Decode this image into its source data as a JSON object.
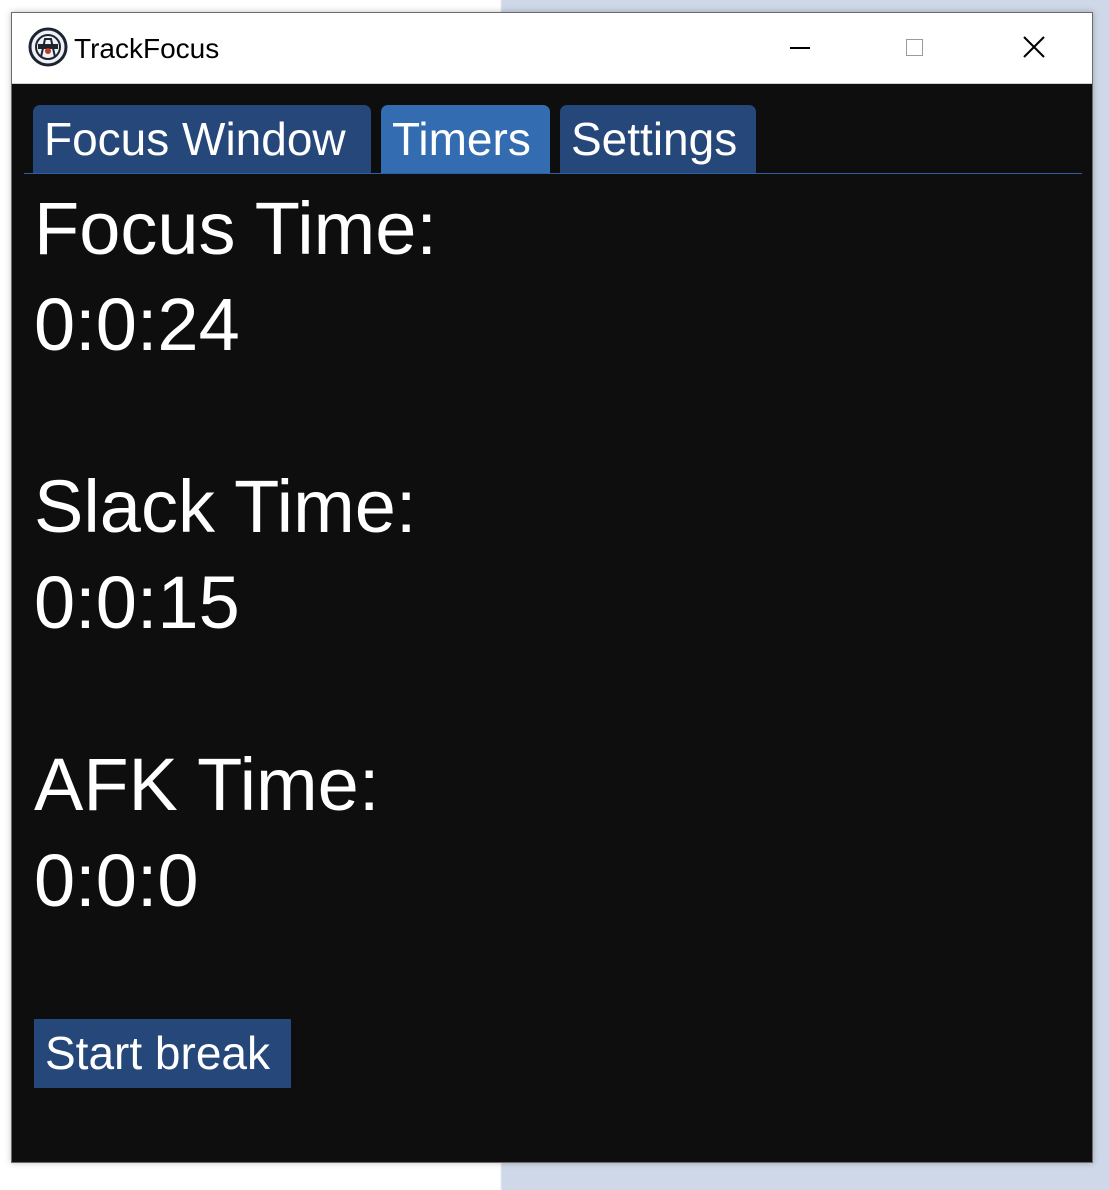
{
  "window": {
    "title": "TrackFocus",
    "controls": {
      "minimize": "minimize-icon",
      "maximize": "maximize-icon",
      "close": "close-icon"
    }
  },
  "tabs": [
    {
      "label": "Focus Window",
      "active": false
    },
    {
      "label": "Timers",
      "active": true
    },
    {
      "label": "Settings",
      "active": false
    }
  ],
  "timers": {
    "focus_label": "Focus Time:",
    "focus_value": "0:0:24",
    "slack_label": "Slack Time:",
    "slack_value": "0:0:15",
    "afk_label": "AFK Time:",
    "afk_value": "0:0:0"
  },
  "actions": {
    "break_button": "Start break"
  },
  "colors": {
    "window_bg": "#0e0e0e",
    "tab_bg": "#25477a",
    "tab_active_bg": "#336cb0",
    "text": "#ffffff"
  }
}
